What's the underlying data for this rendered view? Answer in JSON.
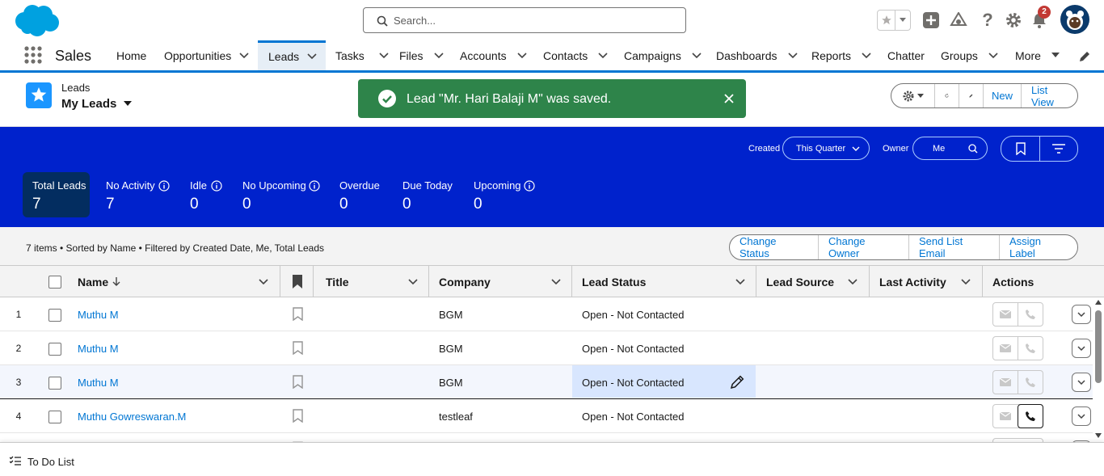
{
  "header": {
    "search_placeholder": "Search...",
    "notification_count": "2"
  },
  "nav": {
    "app_name": "Sales",
    "items": [
      {
        "label": "Home"
      },
      {
        "label": "Opportunities"
      },
      {
        "label": "Leads"
      },
      {
        "label": "Tasks"
      },
      {
        "label": "Files"
      },
      {
        "label": "Accounts"
      },
      {
        "label": "Contacts"
      },
      {
        "label": "Campaigns"
      },
      {
        "label": "Dashboards"
      },
      {
        "label": "Reports"
      },
      {
        "label": "Chatter"
      },
      {
        "label": "Groups"
      },
      {
        "label": "More"
      }
    ],
    "active": "Leads"
  },
  "listview": {
    "object_label": "Leads",
    "name": "My Leads",
    "new_label": "New",
    "listview_label": "List View"
  },
  "toast": {
    "message": "Lead \"Mr. Hari Balaji M\" was saved."
  },
  "filters": {
    "created_label": "Created",
    "created_value": "This Quarter",
    "owner_label": "Owner",
    "owner_value": "Me"
  },
  "kpis": [
    {
      "label": "Total Leads",
      "value": "7"
    },
    {
      "label": "No Activity",
      "value": "7"
    },
    {
      "label": "Idle",
      "value": "0"
    },
    {
      "label": "No Upcoming",
      "value": "0"
    },
    {
      "label": "Overdue",
      "value": "0"
    },
    {
      "label": "Due Today",
      "value": "0"
    },
    {
      "label": "Upcoming",
      "value": "0"
    }
  ],
  "summary": {
    "text": "7 items • Sorted by Name • Filtered by Created Date, Me, Total Leads",
    "actions": [
      "Change Status",
      "Change Owner",
      "Send List Email",
      "Assign Label"
    ]
  },
  "table": {
    "columns": [
      "Name",
      "Title",
      "Company",
      "Lead Status",
      "Lead Source",
      "Last Activity",
      "Actions"
    ],
    "rows": [
      {
        "num": "1",
        "name": "Muthu M",
        "title": "",
        "company": "BGM",
        "status": "Open - Not Contacted",
        "source": "",
        "last_activity": ""
      },
      {
        "num": "2",
        "name": "Muthu M",
        "title": "",
        "company": "BGM",
        "status": "Open - Not Contacted",
        "source": "",
        "last_activity": ""
      },
      {
        "num": "3",
        "name": "Muthu M",
        "title": "",
        "company": "BGM",
        "status": "Open - Not Contacted",
        "source": "",
        "last_activity": ""
      },
      {
        "num": "4",
        "name": "Muthu Gowreswaran.M",
        "title": "",
        "company": "testleaf",
        "status": "Open - Not Contacted",
        "source": "",
        "last_activity": ""
      }
    ]
  },
  "footer": {
    "todo_label": "To Do List"
  },
  "colors": {
    "accent": "#0176d3",
    "kpi_band": "#0022cc",
    "toast_success": "#2e844a"
  }
}
